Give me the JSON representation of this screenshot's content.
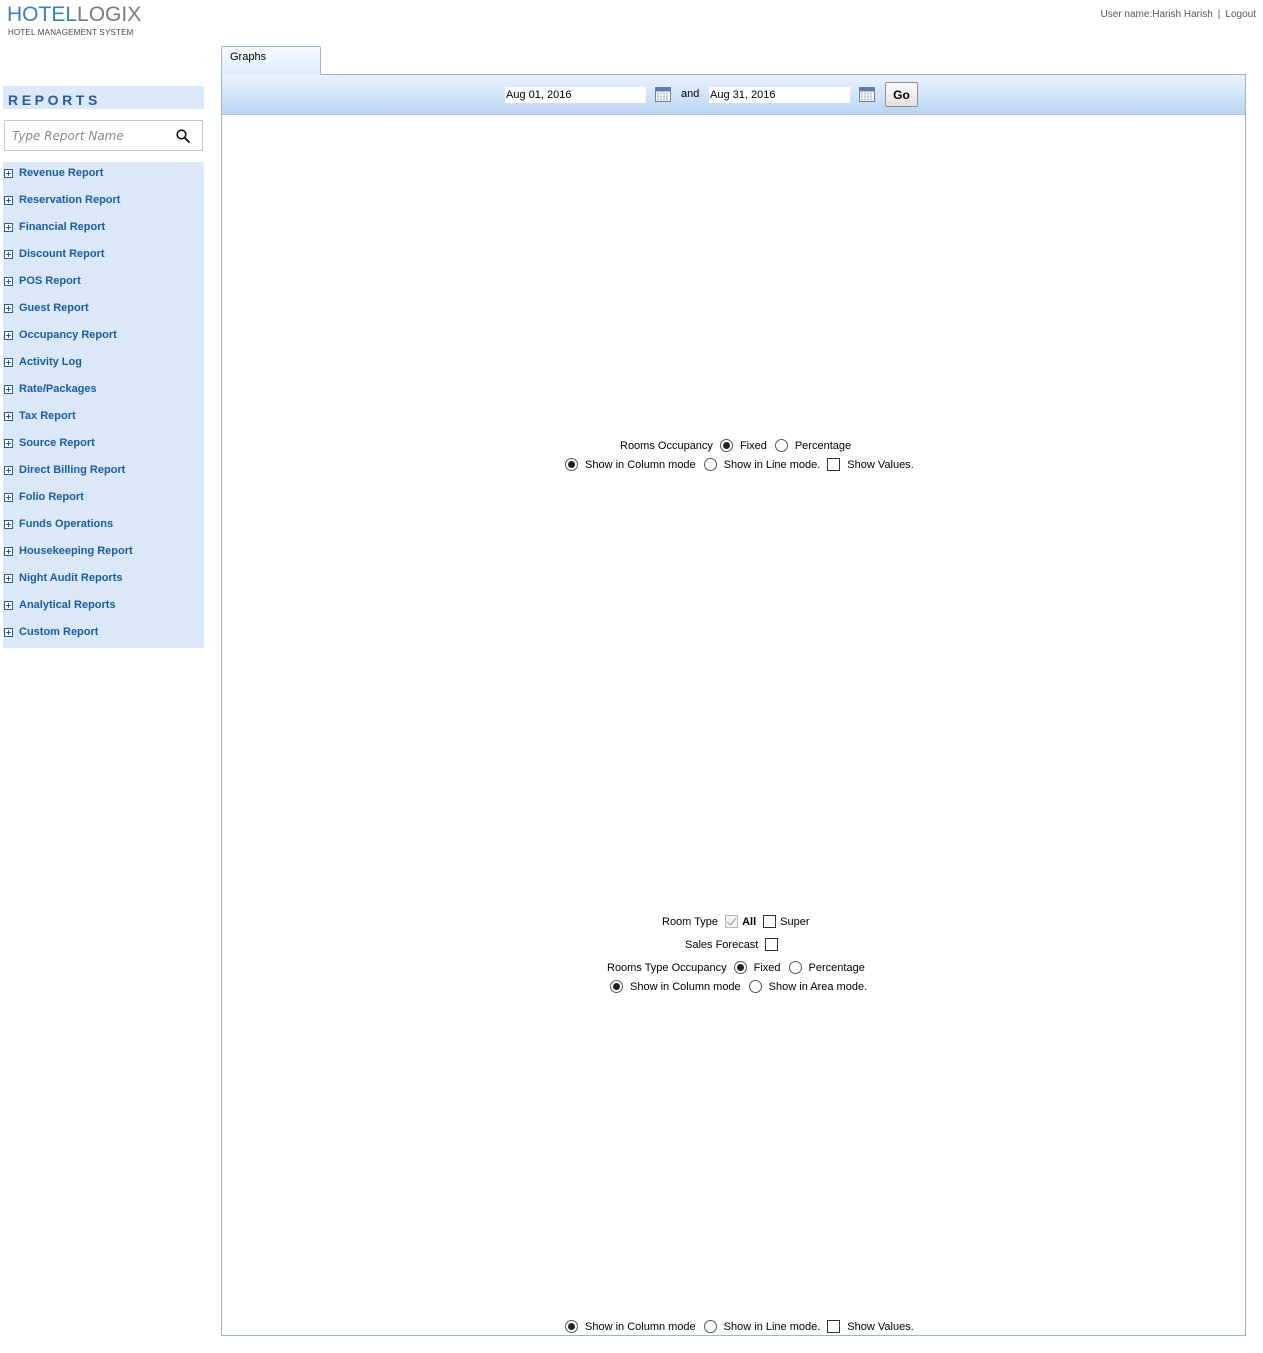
{
  "header": {
    "logo_hotel": "HOTEL",
    "logo_logix": "LOGIX",
    "logo_subtitle": "HOTEL MANAGEMENT SYSTEM",
    "user_name": "User name:Harish Harish",
    "separator": "|",
    "logout": "Logout"
  },
  "sidebar": {
    "title": "REPORTS",
    "search_placeholder": "Type Report Name",
    "items": [
      {
        "label": "Revenue Report"
      },
      {
        "label": "Reservation Report"
      },
      {
        "label": "Financial Report"
      },
      {
        "label": "Discount Report"
      },
      {
        "label": "POS Report"
      },
      {
        "label": "Guest Report"
      },
      {
        "label": "Occupancy Report"
      },
      {
        "label": "Activity Log"
      },
      {
        "label": "Rate/Packages"
      },
      {
        "label": "Tax Report"
      },
      {
        "label": "Source Report"
      },
      {
        "label": "Direct Billing Report"
      },
      {
        "label": "Folio Report"
      },
      {
        "label": "Funds Operations"
      },
      {
        "label": "Housekeeping Report"
      },
      {
        "label": "Night Audit Reports"
      },
      {
        "label": "Analytical Reports"
      },
      {
        "label": "Custom Report"
      }
    ]
  },
  "tabs": [
    {
      "label": "Graphs"
    }
  ],
  "toolbar": {
    "start_date": "Aug 01, 2016",
    "and_label": "and",
    "end_date": "Aug 31, 2016",
    "go_label": "Go"
  },
  "rooms_occupancy": {
    "label": "Rooms Occupancy",
    "fixed": "Fixed",
    "percentage": "Percentage",
    "selected": "Fixed",
    "column_mode": "Show in Column mode",
    "line_mode": "Show in Line mode.",
    "show_values": "Show Values.",
    "mode_selected": "Column"
  },
  "room_type": {
    "label": "Room Type",
    "all": "All",
    "super": "Super",
    "sales_forecast": "Sales Forecast",
    "occupancy_label": "Rooms Type Occupancy",
    "fixed": "Fixed",
    "percentage": "Percentage",
    "selected": "Fixed",
    "column_mode": "Show in Column mode",
    "area_mode": "Show in Area mode.",
    "mode_selected": "Column"
  },
  "bottom_chart": {
    "column_mode": "Show in Column mode",
    "line_mode": "Show in Line mode.",
    "show_values": "Show Values.",
    "mode_selected": "Column"
  },
  "colors": {
    "brand_blue": "#3d7ebd",
    "menu_text": "#1c5c9c",
    "sidebar_bg": "#dbe8f7"
  }
}
